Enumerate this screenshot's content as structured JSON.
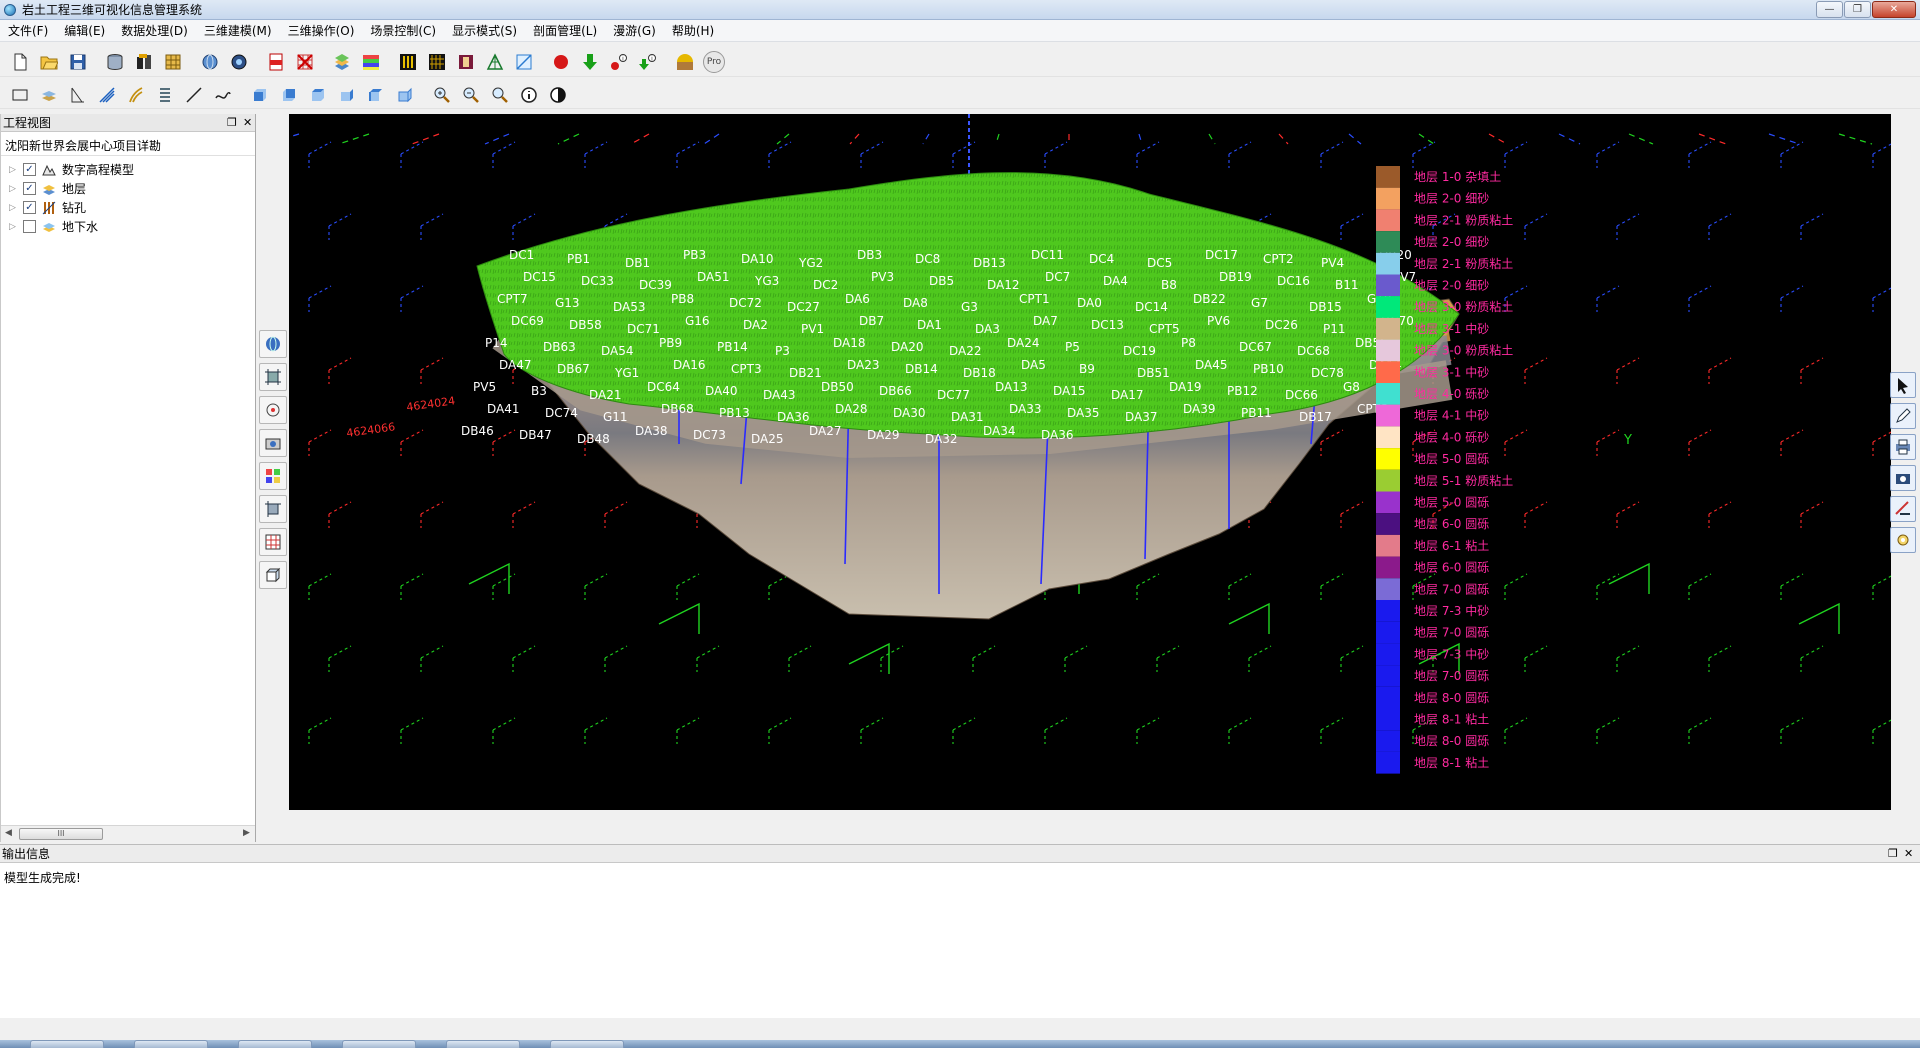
{
  "window": {
    "title": "岩土工程三维可视化信息管理系统",
    "controls": [
      "—",
      "❐",
      "✕"
    ]
  },
  "menu": [
    "文件(F)",
    "编辑(E)",
    "数据处理(D)",
    "三维建模(M)",
    "三维操作(O)",
    "场景控制(C)",
    "显示模式(S)",
    "剖面管理(L)",
    "漫游(G)",
    "帮助(H)"
  ],
  "toolbar": {
    "pro_label": "Pro",
    "row1_icons": [
      "new-file-icon",
      "open-folder-icon",
      "save-icon",
      "database-icon",
      "import-icon",
      "table-icon",
      "globe-icon",
      "network-icon",
      "pdf-icon",
      "grid-delete-icon",
      "layers-icon",
      "color-map-icon",
      "borehole-grid-icon",
      "mesh-icon",
      "book-icon",
      "triangle-icon",
      "slice-icon",
      "record-icon",
      "download-arrow-icon",
      "point-info-icon",
      "point-download-icon",
      "sun-icon",
      "pro-icon"
    ],
    "row2_icons": [
      "rectangle-icon",
      "layers-flat-icon",
      "section-icon",
      "cut-icon",
      "fan-icon",
      "stack-icon",
      "line-icon",
      "curve-icon",
      "cube-front-icon",
      "cube-back-icon",
      "cube-left-icon",
      "cube-right-icon",
      "cube-top-icon",
      "cube-bottom-icon",
      "zoom-in-icon",
      "zoom-out-icon",
      "zoom-fit-icon",
      "info-icon",
      "contrast-icon"
    ]
  },
  "project_panel": {
    "header": "工程视图",
    "project_name": "沈阳新世界会展中心项目详勘",
    "tree": [
      {
        "label": "数字高程模型",
        "checked": true,
        "icon": "dem-icon"
      },
      {
        "label": "地层",
        "checked": true,
        "icon": "stratum-icon"
      },
      {
        "label": "钻孔",
        "checked": true,
        "icon": "borehole-icon"
      },
      {
        "label": "地下水",
        "checked": false,
        "icon": "groundwater-icon"
      }
    ],
    "scroll_thumb": "III"
  },
  "viewport": {
    "background": "#000000",
    "terrain_color": "#4fc81e",
    "axis_labels": {
      "x1": "4624024",
      "x2": "4624066",
      "y": "Y"
    },
    "boreholes": [
      "DC1",
      "PB1",
      "DB1",
      "PB3",
      "DA10",
      "YG2",
      "DB3",
      "DC8",
      "DB13",
      "DC11",
      "DC4",
      "DC5",
      "DC17",
      "CPT2",
      "PV4",
      "DB20",
      "DC15",
      "DC33",
      "DC39",
      "DA51",
      "YG3",
      "DC2",
      "PV3",
      "DB5",
      "DA12",
      "DC7",
      "DA4",
      "B8",
      "DB19",
      "DC16",
      "B11",
      "PV7",
      "CPT7",
      "G13",
      "DA53",
      "PB8",
      "DC72",
      "DC27",
      "DA6",
      "DA8",
      "G3",
      "CPT1",
      "DA0",
      "DC14",
      "DB22",
      "G7",
      "DB15",
      "G10",
      "DC69",
      "DB58",
      "DC71",
      "G16",
      "DA2",
      "PV1",
      "DB7",
      "DA1",
      "DA3",
      "DA7",
      "DC13",
      "CPT5",
      "PV6",
      "DC26",
      "P11",
      "DC70",
      "P14",
      "DB63",
      "DA54",
      "PB9",
      "PB14",
      "P3",
      "DA18",
      "DA20",
      "DA22",
      "DA24",
      "P5",
      "DC19",
      "P8",
      "DC67",
      "DC68",
      "DB55",
      "DA47",
      "DB67",
      "YG1",
      "DA16",
      "CPT3",
      "DB21",
      "DA23",
      "DB14",
      "DB18",
      "DA5",
      "B9",
      "DB51",
      "DA45",
      "PB10",
      "DC78",
      "DA14",
      "PV5",
      "B3",
      "DA21",
      "DC64",
      "DA40",
      "DA43",
      "DB50",
      "DB66",
      "DC77",
      "DA13",
      "DA15",
      "DA17",
      "DA19",
      "PB12",
      "DC66",
      "G8",
      "DA41",
      "DC74",
      "G11",
      "DB68",
      "PB13",
      "DA36",
      "DA28",
      "DA30",
      "DA31",
      "DA33",
      "DA35",
      "DA37",
      "DA39",
      "PB11",
      "DB17",
      "CPT6",
      "DB46",
      "DB47",
      "DB48",
      "DA38",
      "DC73",
      "DA25",
      "DA27",
      "DA29",
      "DA32",
      "DA34",
      "DA36"
    ]
  },
  "legend": [
    {
      "label": "地层 1-0 杂填土",
      "color": "#9b5a2a"
    },
    {
      "label": "地层 2-0 细砂",
      "color": "#f3a160"
    },
    {
      "label": "地层 2-1 粉质粘土",
      "color": "#f08070"
    },
    {
      "label": "地层 2-0 细砂",
      "color": "#2e8b57"
    },
    {
      "label": "地层 2-1 粉质粘土",
      "color": "#87ceeb"
    },
    {
      "label": "地层 2-0 细砂",
      "color": "#6a5acd"
    },
    {
      "label": "地层 3-0 粉质粘土",
      "color": "#00e87a"
    },
    {
      "label": "地层 3-1 中砂",
      "color": "#d2b48c"
    },
    {
      "label": "地层 3-0 粉质粘土",
      "color": "#e6c8dc"
    },
    {
      "label": "地层 3-1 中砂",
      "color": "#ff6a4a"
    },
    {
      "label": "地层 4-0 砾砂",
      "color": "#40e0d0"
    },
    {
      "label": "地层 4-1 中砂",
      "color": "#ee68d8"
    },
    {
      "label": "地层 4-0 砾砂",
      "color": "#ffe4c4"
    },
    {
      "label": "地层 5-0 圆砾",
      "color": "#ffff00"
    },
    {
      "label": "地层 5-1 粉质粘土",
      "color": "#9acd32"
    },
    {
      "label": "地层 5-0 圆砾",
      "color": "#9932cc"
    },
    {
      "label": "地层 6-0 圆砾",
      "color": "#4b1080"
    },
    {
      "label": "地层 6-1 粘土",
      "color": "#e37b8a"
    },
    {
      "label": "地层 6-0 圆砾",
      "color": "#8b1a8b"
    },
    {
      "label": "地层 7-0 圆砾",
      "color": "#7b6bd6"
    },
    {
      "label": "地层 7-3 中砂",
      "color": "#1a1aee"
    },
    {
      "label": "地层 7-0 圆砾",
      "color": "#1a1aee"
    },
    {
      "label": "地层 7-3 中砂",
      "color": "#1a1aee"
    },
    {
      "label": "地层 7-0 圆砾",
      "color": "#1a1aee"
    },
    {
      "label": "地层 8-0 圆砾",
      "color": "#1a1aee"
    },
    {
      "label": "地层 8-1 粘土",
      "color": "#1a1aee"
    },
    {
      "label": "地层 8-0 圆砾",
      "color": "#1a1aee"
    },
    {
      "label": "地层 8-1 粘土",
      "color": "#1a1aee"
    }
  ],
  "output_panel": {
    "header": "输出信息",
    "message": "模型生成完成!"
  }
}
